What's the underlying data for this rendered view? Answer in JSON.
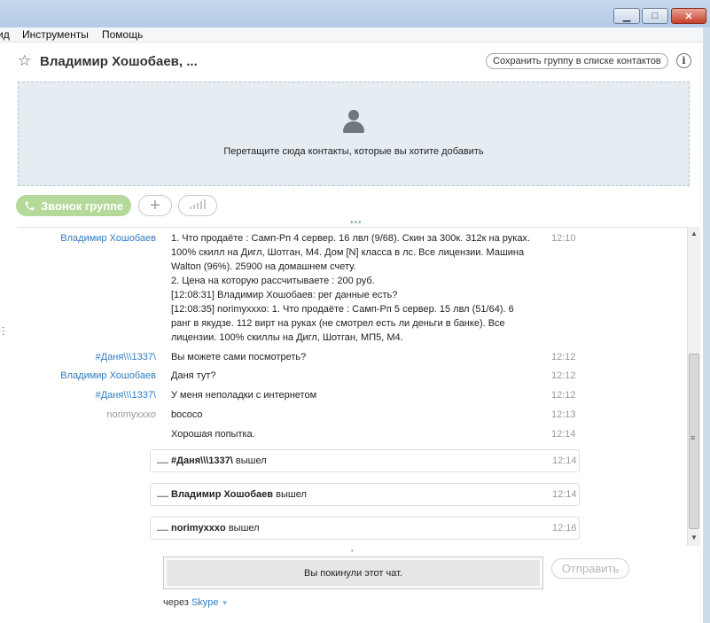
{
  "menu": {
    "items": [
      "ид",
      "Инструменты",
      "Помощь"
    ]
  },
  "header": {
    "title": "Владимир Хошобаев, ...",
    "save_group": "Сохранить группу в списке контактов",
    "info": "i"
  },
  "dropzone": {
    "text": "Перетащите сюда контакты, которые вы хотите добавить"
  },
  "call": {
    "group_call": "Звонок группе",
    "add": "+"
  },
  "messages": [
    {
      "sender": "Владимир Хошобаев",
      "lines": [
        "1. Что продаёте : Самп-Рп 4 сервер. 16 лвл (9/68). Скин за 300к. 312к на руках. 100% скилл на Дигл, Шотган, М4. Дом [N] класса в лс. Все лицензии. Машина Walton (96%). 25900 на домашнем счету.",
        "2. Цена на которую рассчитываете : 200 руб.",
        "[12:08:31] Владимир Хошобаев: рег данные есть?",
        "[12:08:35] norimyxxxo: 1. Что продаёте : Самп-Рп 5 сервер. 15 лвл (51/64). 6 ранг в якудзе. 112 вирт на руках (не смотрел есть ли деньги в банке). Все лицензии. 100% скиллы на Дигл, Шотган, МП5, М4."
      ],
      "time": "12:10"
    },
    {
      "sender": "#Даня\\\\\\1337\\",
      "lines": [
        "Вы можете сами посмотреть?"
      ],
      "time": "12:12"
    },
    {
      "sender": "Владимир Хошобаев",
      "lines": [
        "Даня тут?"
      ],
      "time": "12:12"
    },
    {
      "sender": "#Даня\\\\\\1337\\",
      "lines": [
        "У меня неполадки с интернетом"
      ],
      "time": "12:12"
    },
    {
      "sender": "norimyxxxo",
      "lines": [
        "bococo"
      ],
      "time": "12:13"
    },
    {
      "sender": "",
      "lines": [
        "Хорошая попытка."
      ],
      "time": "12:14"
    }
  ],
  "events": [
    {
      "dash": "—",
      "name": "#Даня\\\\\\1337\\",
      "action": "вышел",
      "time": "12:14"
    },
    {
      "dash": "—",
      "name": "Владимир Хошобаев",
      "action": "вышел",
      "time": "12:14"
    },
    {
      "dash": "—",
      "name": "norimyxxxo",
      "action": "вышел",
      "time": "12:16"
    }
  ],
  "composer": {
    "left_chat": "Вы покинули этот чат.",
    "send": "Отправить"
  },
  "via": {
    "prefix": "через",
    "service": "Skype"
  },
  "colors": {
    "accent": "#2f7cc2",
    "call_button": "#b4d99a",
    "dropzone_bg": "#e6edf2"
  }
}
